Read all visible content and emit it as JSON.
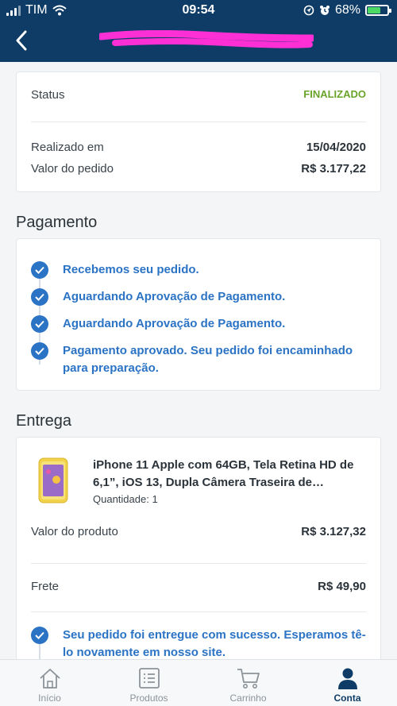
{
  "status_bar": {
    "carrier": "TIM",
    "time": "09:54",
    "battery": "68%",
    "battery_level": 0.68
  },
  "order": {
    "status_label": "Status",
    "status_value": "FINALIZADO",
    "date_label": "Realizado em",
    "date_value": "15/04/2020",
    "total_label": "Valor do pedido",
    "total_value": "R$ 3.177,22"
  },
  "payment": {
    "title": "Pagamento",
    "steps": [
      "Recebemos seu pedido.",
      "Aguardando Aprovação de Pagamento.",
      "Aguardando Aprovação de Pagamento.",
      "Pagamento aprovado. Seu pedido foi encaminhado para preparação."
    ]
  },
  "delivery": {
    "title": "Entrega",
    "product_name": "iPhone 11 Apple com 64GB, Tela Retina HD de 6,1”, iOS 13, Dupla Câmera Traseira de…",
    "quantity": "Quantidade: 1",
    "product_value_label": "Valor do produto",
    "product_value": "R$ 3.127,32",
    "shipping_label": "Frete",
    "shipping_value": "R$ 49,90",
    "delivery_step": "Seu pedido foi entregue com sucesso. Esperamos tê-lo novamente em nosso site."
  },
  "tabs": [
    {
      "label": "Início",
      "icon": "home-icon",
      "active": false
    },
    {
      "label": "Produtos",
      "icon": "list-icon",
      "active": false
    },
    {
      "label": "Carrinho",
      "icon": "cart-icon",
      "active": false
    },
    {
      "label": "Conta",
      "icon": "user-icon",
      "active": true
    }
  ],
  "colors": {
    "brand": "#0e3c66",
    "accent": "#2b73c4",
    "success": "#6aa32a",
    "redaction": "#ff2fd6"
  }
}
